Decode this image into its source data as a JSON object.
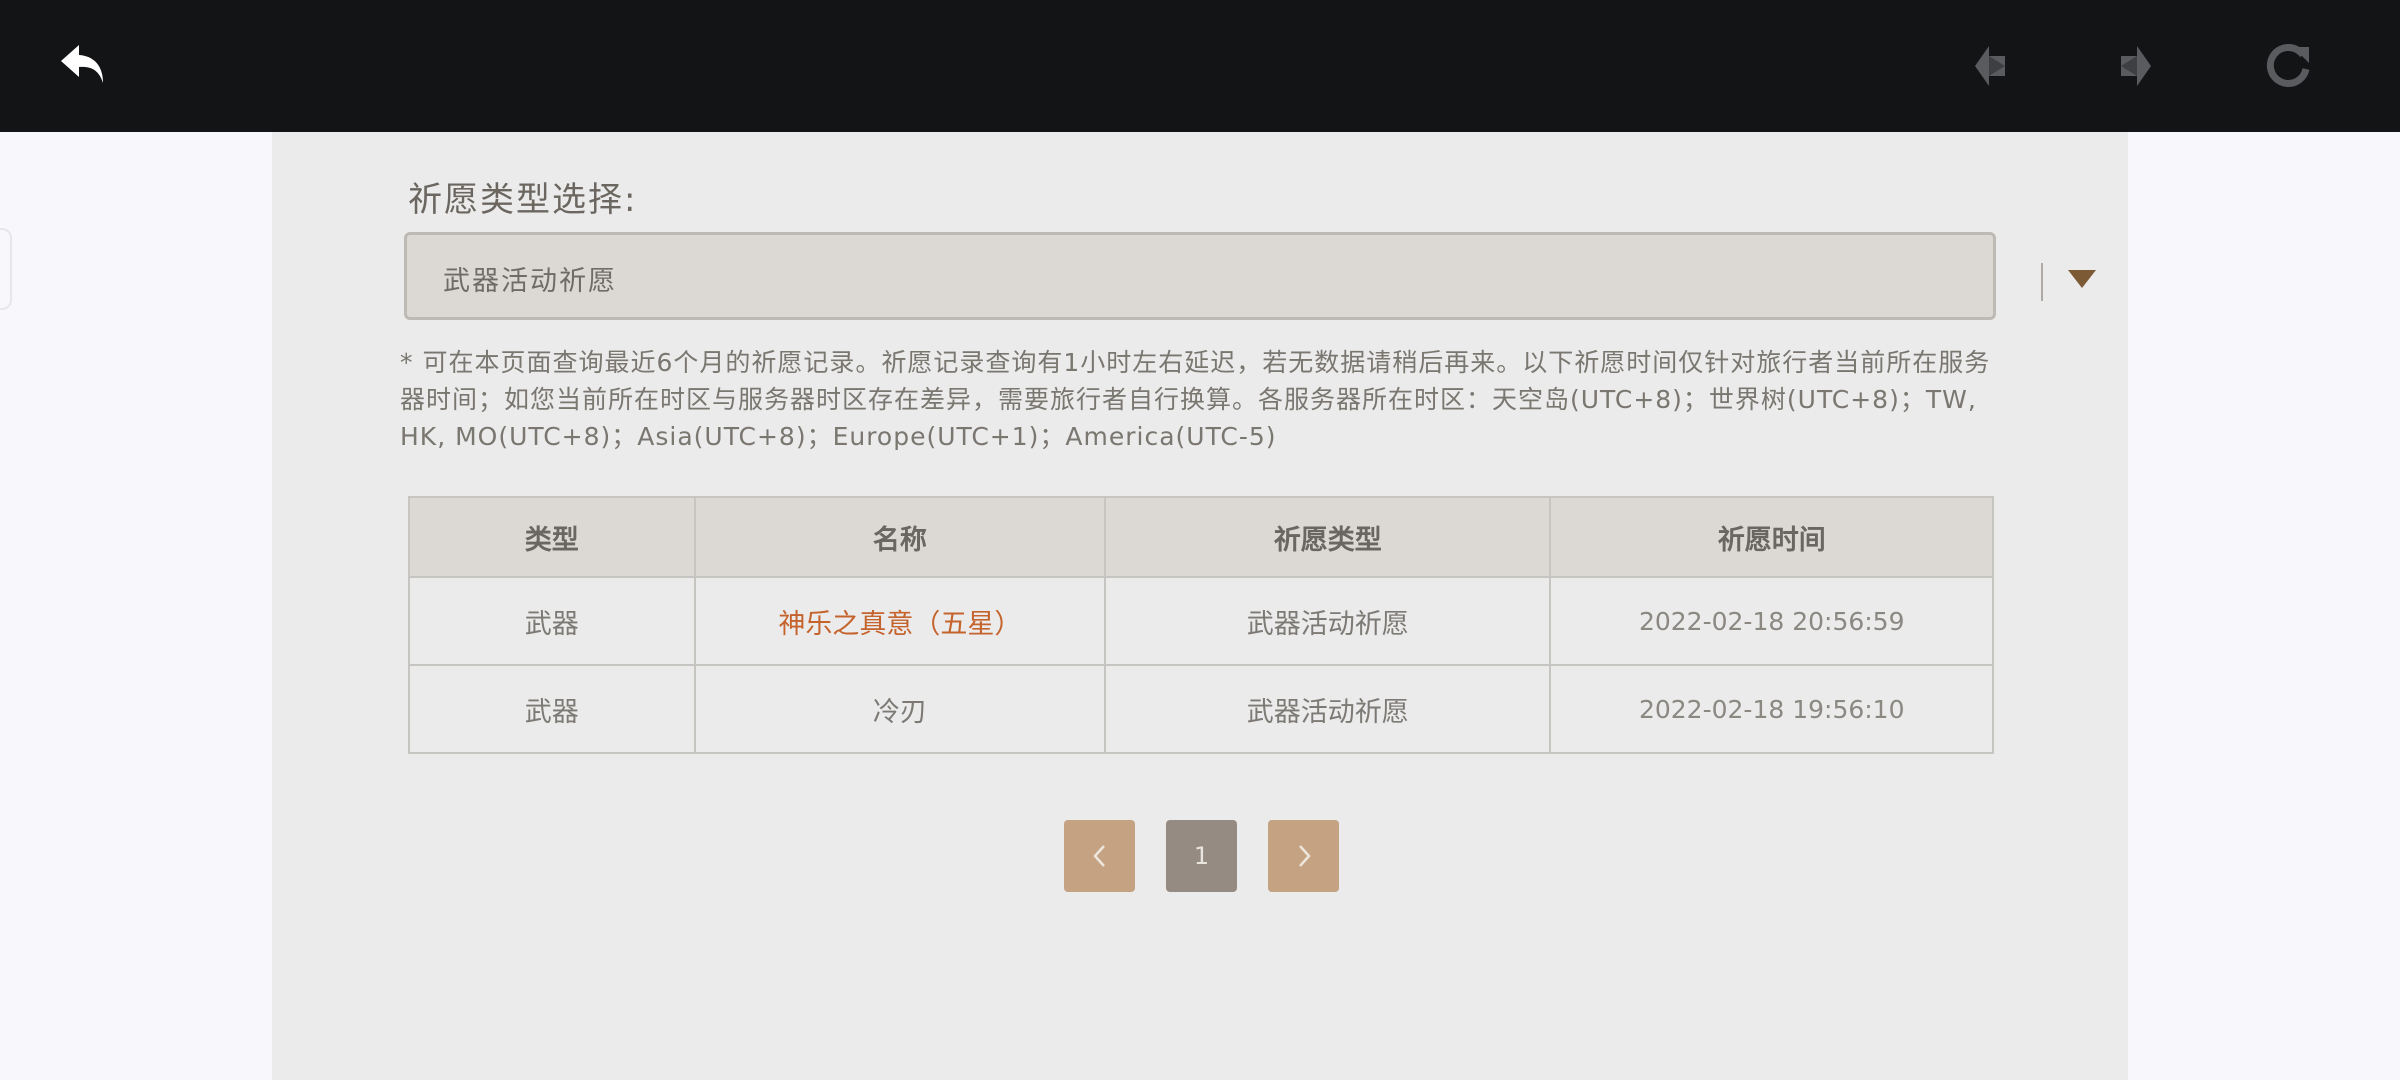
{
  "browser": {
    "icons": {
      "back": "back-arrow-icon",
      "prev": "prev-diamond-icon",
      "next": "next-diamond-icon",
      "reload": "reload-icon"
    },
    "colors": {
      "bar": "#131416",
      "active_icon": "#ffffff",
      "inactive_icon": "#5a5b5e"
    }
  },
  "filter": {
    "label": "祈愿类型选择:",
    "selected": "武器活动祈愿"
  },
  "notice": "* 可在本页面查询最近6个月的祈愿记录。祈愿记录查询有1小时左右延迟，若无数据请稍后再来。以下祈愿时间仅针对旅行者当前所在服务器时间；如您当前所在时区与服务器时区存在差异，需要旅行者自行换算。各服务器所在时区：天空岛(UTC+8)；世界树(UTC+8)；TW, HK, MO(UTC+8)；Asia(UTC+8)；Europe(UTC+1)；America(UTC-5)",
  "table": {
    "headers": [
      "类型",
      "名称",
      "祈愿类型",
      "祈愿时间"
    ],
    "rows": [
      {
        "type": "武器",
        "name": "神乐之真意（五星）",
        "wish_type": "武器活动祈愿",
        "time": "2022-02-18 20:56:59",
        "rarity": "five-star"
      },
      {
        "type": "武器",
        "name": "冷刃",
        "wish_type": "武器活动祈愿",
        "time": "2022-02-18 19:56:10",
        "rarity": "three-star"
      }
    ]
  },
  "pagination": {
    "current_page": "1",
    "prev_icon": "chevron-left-icon",
    "next_icon": "chevron-right-icon"
  },
  "colors": {
    "five_star": "#c5632c",
    "pager_nav": "#c5a282",
    "pager_current": "#958b83",
    "select_arrow": "#7c5a35"
  }
}
